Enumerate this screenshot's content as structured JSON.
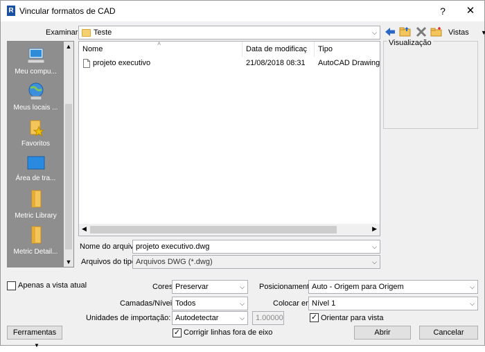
{
  "titlebar": {
    "title": "Vincular formatos de CAD",
    "app_icon_letter": "R",
    "help_label": "?",
    "close_label": "✕"
  },
  "look_in": {
    "label": "Examinar:",
    "value": "Teste"
  },
  "toolbar": {
    "views_label": "Vistas"
  },
  "sidebar": {
    "items": [
      {
        "label": "Meu compu...",
        "icon": "computer-icon"
      },
      {
        "label": "Meus locais ...",
        "icon": "network-globe-icon"
      },
      {
        "label": "Favoritos",
        "icon": "favorites-folder-icon"
      },
      {
        "label": "Área de tra...",
        "icon": "desktop-icon"
      },
      {
        "label": "Metric Library",
        "icon": "folder-icon"
      },
      {
        "label": "Metric Detail...",
        "icon": "folder-icon"
      }
    ]
  },
  "file_list": {
    "columns": [
      "Nome",
      "Data de modificaç",
      "Tipo"
    ],
    "rows": [
      {
        "name": "projeto executivo",
        "date": "21/08/2018 08:31",
        "type": "AutoCAD Drawing"
      }
    ]
  },
  "preview": {
    "label": "Visualização"
  },
  "filename": {
    "label": "Nome do arquivo:",
    "value": "projeto executivo.dwg"
  },
  "filetype": {
    "label": "Arquivos do tipo:",
    "value": "Arquivos DWG  (*.dwg)"
  },
  "options": {
    "current_view_only": {
      "label": "Apenas a vista atual",
      "checked": false
    },
    "colors": {
      "label": "Cores",
      "value": "Preservar"
    },
    "layers": {
      "label": "Camadas/Níveis:",
      "value": "Todos"
    },
    "import_units": {
      "label": "Unidades de importação:",
      "value": "Autodetectar",
      "scale": "1.000000"
    },
    "fix_lines": {
      "label": "Corrigir linhas fora de eixo",
      "checked": true
    },
    "positioning": {
      "label": "Posicionamento:",
      "value": "Auto - Origem para Origem"
    },
    "place_at": {
      "label": "Colocar em:",
      "value": "Nível 1"
    },
    "orient_to_view": {
      "label": "Orientar para vista",
      "checked": true
    }
  },
  "buttons": {
    "tools": "Ferramentas",
    "open": "Abrir",
    "cancel": "Cancelar"
  }
}
